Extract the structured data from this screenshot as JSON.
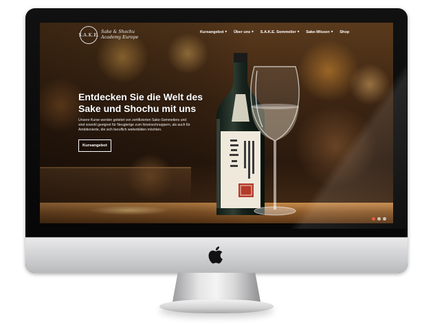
{
  "site": {
    "logo_mark": "S.A.K.E.",
    "logo_line1": "Sake & Shochu",
    "logo_line2": "Academy Europe"
  },
  "nav": {
    "items": [
      {
        "label": "Kursangebot",
        "dropdown": true
      },
      {
        "label": "Über uns",
        "dropdown": true
      },
      {
        "label": "S.A.K.E. Sommelier",
        "dropdown": true
      },
      {
        "label": "Sake-Wissen",
        "dropdown": true
      },
      {
        "label": "Shop",
        "dropdown": false
      }
    ],
    "chevron": "▾"
  },
  "hero": {
    "title_line1": "Entdecken Sie die Welt des",
    "title_line2": "Sake und Shochu mit uns",
    "text_line1": "Unsere Kurse werden geleitet von zertifizierten Sake-Sommeliers und",
    "text_line2": "sind sowohl geeignet für Neugierige zum hineinschnuppern, als auch für",
    "text_line3": "Ambitionierte, die sich beruflich weiterbilden möchten.",
    "button_label": "Kursangebot"
  },
  "slider": {
    "dot_count": 3,
    "active_index": 0,
    "active_color": "#e2543a"
  },
  "icons": {
    "device_logo": "apple-icon"
  }
}
